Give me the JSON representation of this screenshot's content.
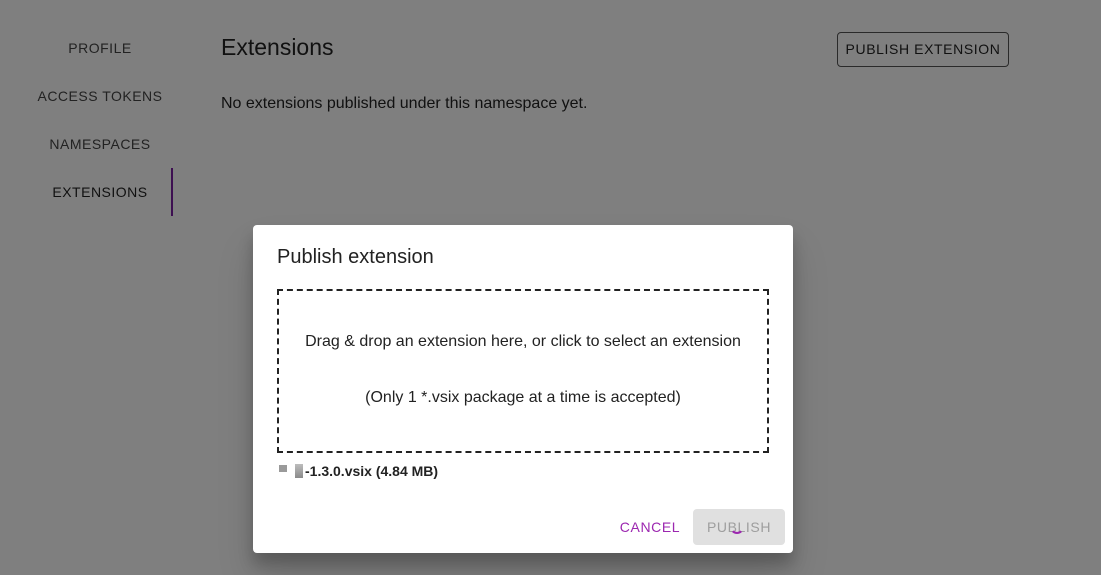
{
  "sidebar": {
    "items": [
      {
        "label": "PROFILE"
      },
      {
        "label": "ACCESS TOKENS"
      },
      {
        "label": "NAMESPACES"
      },
      {
        "label": "EXTENSIONS",
        "active": true
      }
    ]
  },
  "main": {
    "title": "Extensions",
    "empty_message": "No extensions published under this namespace yet.",
    "publish_button": "PUBLISH EXTENSION"
  },
  "dialog": {
    "title": "Publish extension",
    "dropzone_text": "Drag & drop an extension here, or click to select an extension",
    "dropzone_note": "(Only 1 *.vsix package at a time is accepted)",
    "file_name": "-1.3.0.vsix (4.84 MB)",
    "cancel_label": "CANCEL",
    "publish_label": "PUBLISH",
    "publish_loading": true
  },
  "colors": {
    "accent": "#9c27b0",
    "indicator": "#7b1fa2"
  }
}
